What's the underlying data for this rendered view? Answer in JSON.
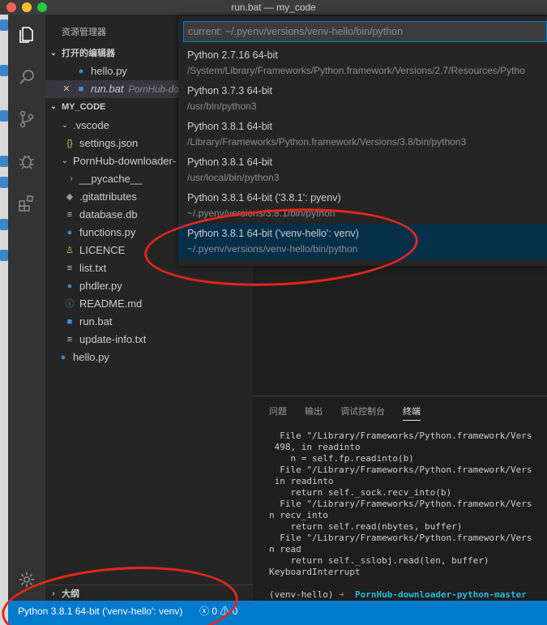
{
  "window": {
    "title": "run.bat — my_code"
  },
  "sidebar": {
    "title": "资源管理器",
    "open_editors": {
      "label": "打开的编辑器",
      "items": [
        {
          "name": "hello.py",
          "icon": "python-icon"
        },
        {
          "name": "run.bat",
          "path": "PornHub-do",
          "icon": "windows-icon"
        }
      ]
    },
    "workspace": {
      "label": "MY_CODE",
      "items": [
        {
          "name": ".vscode",
          "type": "folder"
        },
        {
          "name": "settings.json",
          "icon": "json-icon"
        },
        {
          "name": "PornHub-downloader-",
          "type": "folder"
        },
        {
          "name": "__pycache__",
          "type": "folder"
        },
        {
          "name": ".gitattributes",
          "icon": "git-icon"
        },
        {
          "name": "database.db",
          "icon": "file-lines-icon"
        },
        {
          "name": "functions.py",
          "icon": "python-icon"
        },
        {
          "name": "LICENCE",
          "icon": "license-icon"
        },
        {
          "name": "list.txt",
          "icon": "file-lines-icon"
        },
        {
          "name": "phdler.py",
          "icon": "python-icon"
        },
        {
          "name": "README.md",
          "icon": "info-icon"
        },
        {
          "name": "run.bat",
          "icon": "windows-icon"
        },
        {
          "name": "update-info.txt",
          "icon": "file-lines-icon"
        },
        {
          "name": "hello.py",
          "icon": "python-icon"
        }
      ]
    },
    "outline": {
      "label": "大纲"
    }
  },
  "quickpick": {
    "input_value": "current: ~/.pyenv/versions/venv-hello/bin/python",
    "items": [
      {
        "label": "Python 2.7.16 64-bit",
        "detail": "/System/Library/Frameworks/Python.framework/Versions/2.7/Resources/Pytho"
      },
      {
        "label": "Python 3.7.3 64-bit",
        "detail": "/usr/bin/python3"
      },
      {
        "label": "Python 3.8.1 64-bit",
        "detail": "/Library/Frameworks/Python.framework/Versions/3.8/bin/python3"
      },
      {
        "label": "Python 3.8.1 64-bit",
        "detail": "/usr/local/bin/python3"
      },
      {
        "label": "Python 3.8.1 64-bit ('3.8.1': pyenv)",
        "detail": "~/.pyenv/versions/3.8.1/bin/python"
      },
      {
        "label": "Python 3.8.1 64-bit ('venv-hello': venv)",
        "detail": "~/.pyenv/versions/venv-hello/bin/python"
      }
    ]
  },
  "panel": {
    "tabs": [
      "问题",
      "输出",
      "调试控制台",
      "终端"
    ],
    "terminal_lines": [
      "  File \"/Library/Frameworks/Python.framework/Vers",
      " 498, in readinto",
      "    n = self.fp.readinto(b)",
      "  File \"/Library/Frameworks/Python.framework/Vers",
      " in readinto",
      "    return self._sock.recv_into(b)",
      "  File \"/Library/Frameworks/Python.framework/Vers",
      "n recv_into",
      "    return self.read(nbytes, buffer)",
      "  File \"/Library/Frameworks/Python.framework/Vers",
      "n read",
      "    return self._sslobj.read(len, buffer)",
      "KeyboardInterrupt"
    ],
    "prompt_env": "(venv-hello)",
    "prompt_arrow": "➜",
    "prompt_dir": "PornHub-downloader-python-master"
  },
  "statusbar": {
    "interpreter": "Python 3.8.1 64-bit ('venv-hello': venv)",
    "errors": "0",
    "warnings": "0"
  },
  "colors": {
    "accent": "#007acc",
    "annotation": "#e8251a"
  }
}
